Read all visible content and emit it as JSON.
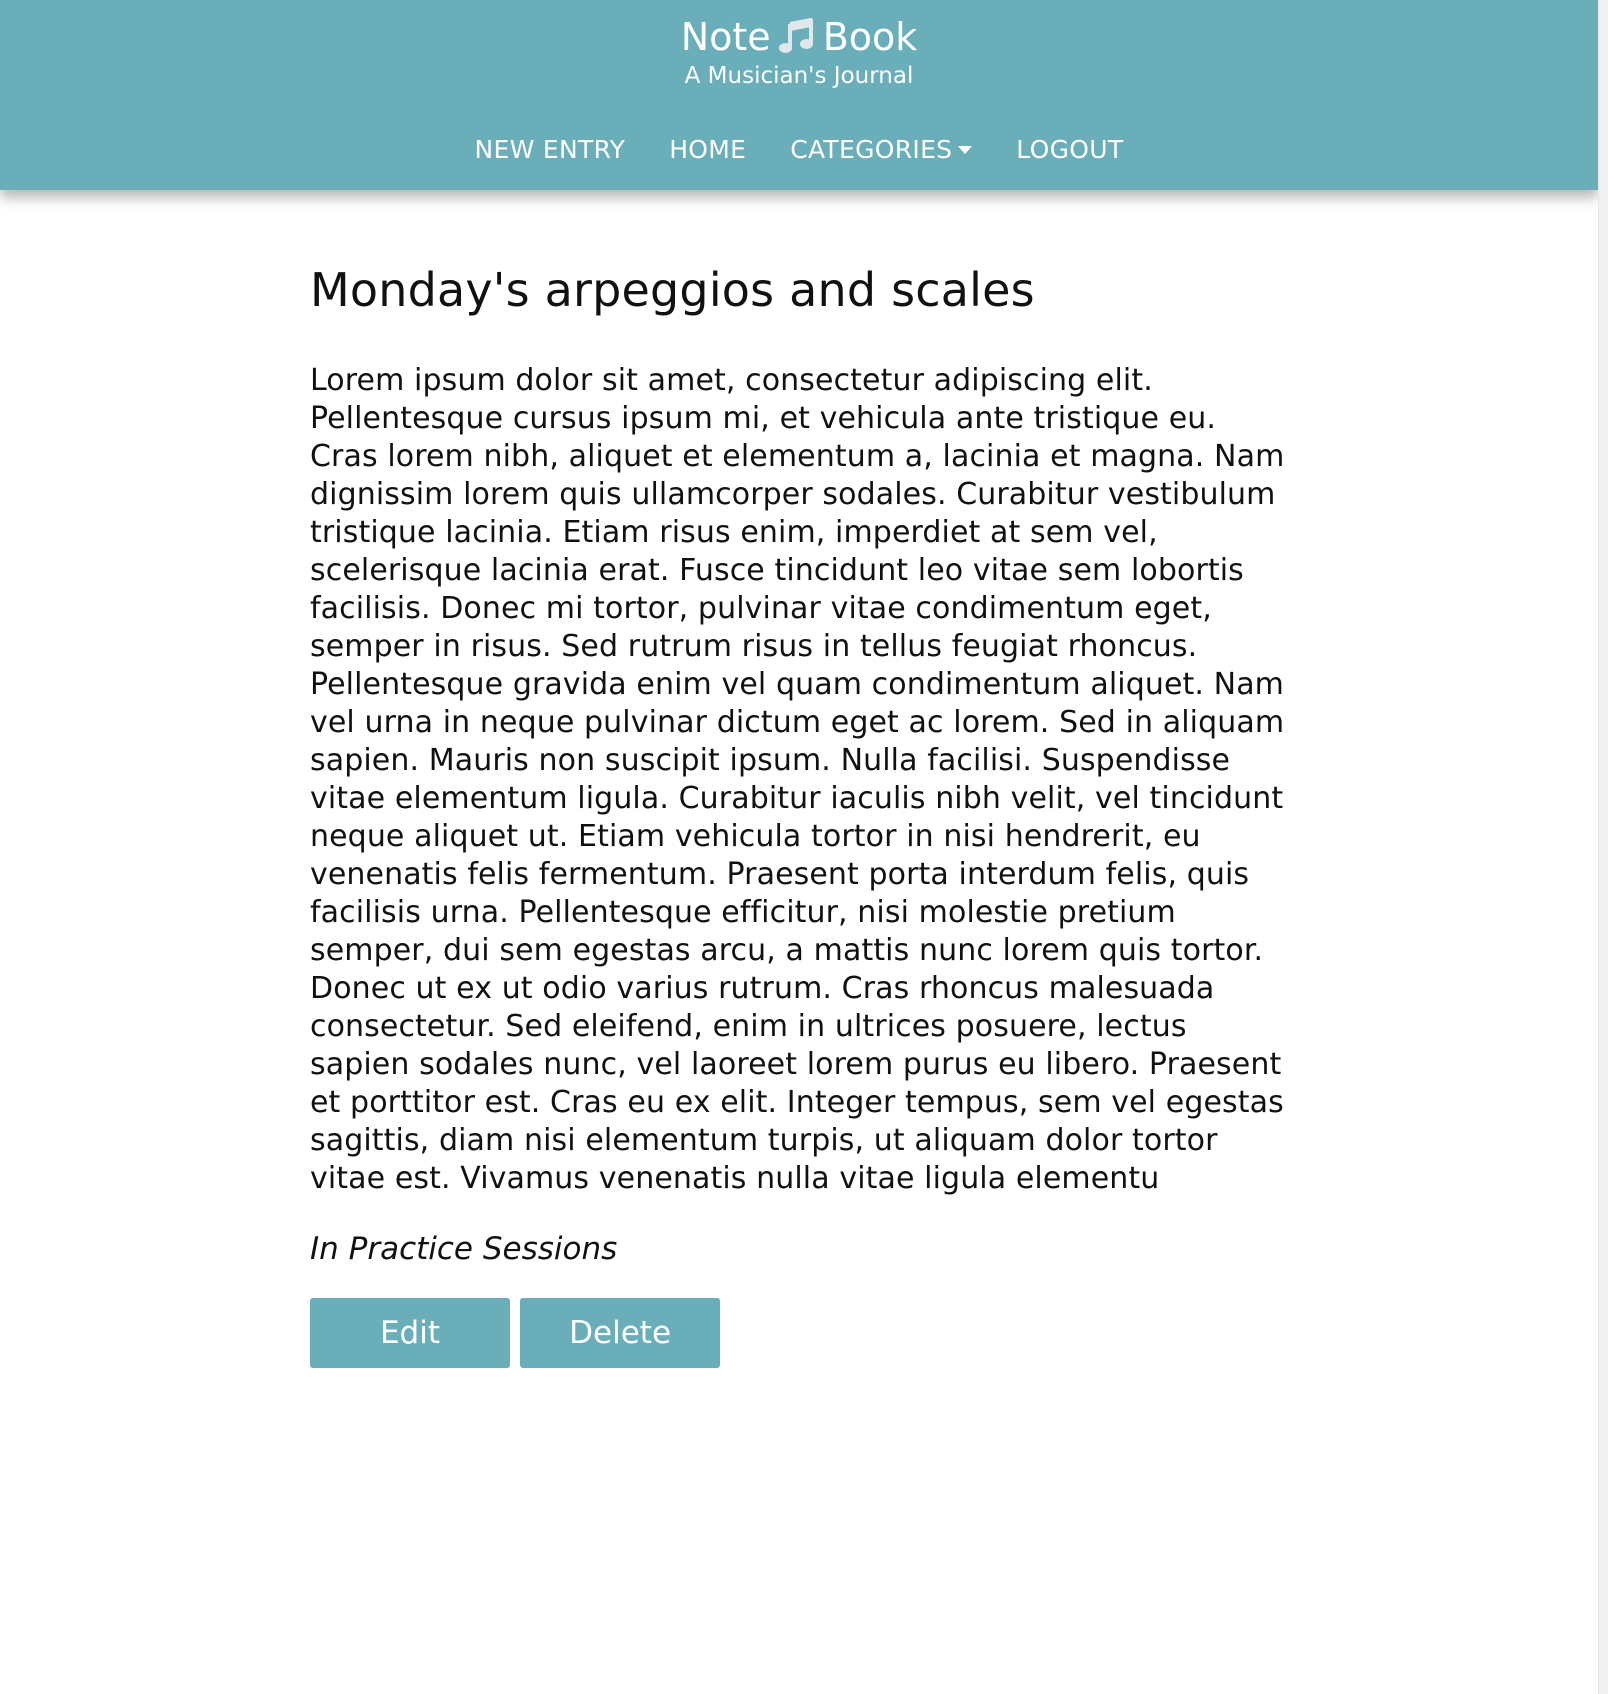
{
  "header": {
    "brand": {
      "title_left": "Note",
      "title_icon": "music-note-icon",
      "title_right": "Book",
      "subtitle": "A Musician's Journal"
    },
    "nav": {
      "new_entry": "NEW ENTRY",
      "home": "HOME",
      "categories": "CATEGORIES",
      "logout": "LOGOUT"
    },
    "colors": {
      "background": "#6aaeba",
      "text": "#ffffff"
    }
  },
  "entry": {
    "title": "Monday's arpeggios and scales",
    "body": "Lorem ipsum dolor sit amet, consectetur adipiscing elit. Pellentesque cursus ipsum mi, et vehicula ante tristique eu. Cras lorem nibh, aliquet et elementum a, lacinia et magna. Nam dignissim lorem quis ullamcorper sodales. Curabitur vestibulum tristique lacinia. Etiam risus enim, imperdiet at sem vel, scelerisque lacinia erat. Fusce tincidunt leo vitae sem lobortis facilisis. Donec mi tortor, pulvinar vitae condimentum eget, semper in risus. Sed rutrum risus in tellus feugiat rhoncus. Pellentesque gravida enim vel quam condimentum aliquet. Nam vel urna in neque pulvinar dictum eget ac lorem. Sed in aliquam sapien. Mauris non suscipit ipsum. Nulla facilisi. Suspendisse vitae elementum ligula. Curabitur iaculis nibh velit, vel tincidunt neque aliquet ut. Etiam vehicula tortor in nisi hendrerit, eu venenatis felis fermentum. Praesent porta interdum felis, quis facilisis urna. Pellentesque efficitur, nisi molestie pretium semper, dui sem egestas arcu, a mattis nunc lorem quis tortor. Donec ut ex ut odio varius rutrum. Cras rhoncus malesuada consectetur. Sed eleifend, enim in ultrices posuere, lectus sapien sodales nunc, vel laoreet lorem purus eu libero. Praesent et porttitor est. Cras eu ex elit. Integer tempus, sem vel egestas sagittis, diam nisi elementum turpis, ut aliquam dolor tortor vitae est. Vivamus venenatis nulla vitae ligula elementu",
    "category_line": "In Practice Sessions"
  },
  "actions": {
    "edit_label": "Edit",
    "delete_label": "Delete",
    "button_color": "#6aaeba"
  }
}
